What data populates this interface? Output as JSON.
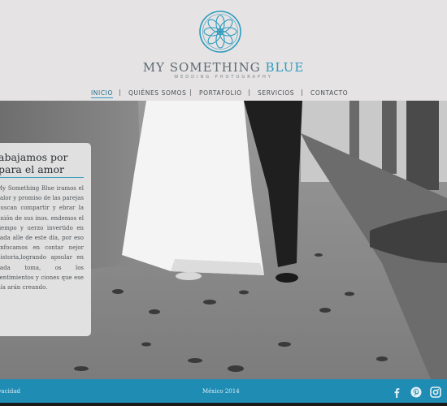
{
  "brand": {
    "name_part1": "MY SOMETHING ",
    "name_part2": "BLUE",
    "tagline": "WEDDING PHOTOGRAPHY",
    "accent_color": "#2d9bbd",
    "logo_icon": "mandala-icon"
  },
  "nav": {
    "items": [
      {
        "label": "INICIO",
        "active": true
      },
      {
        "label": "QUIÉNES SOMOS",
        "active": false
      },
      {
        "label": "PORTAFOLIO",
        "active": false
      },
      {
        "label": "SERVICIOS",
        "active": false
      },
      {
        "label": "CONTACTO",
        "active": false
      }
    ],
    "separator": "|"
  },
  "card": {
    "title": "abajamos por\npara el amor",
    "body": "My Something Blue iramos el valor y promiso de las parejas buscan compartir y ebrar la unión de sus inos. endemos el tiempo y uerzo invertido en cada alle de este día, por eso enfocamos en contar nejor historia,logrando apsular en cada toma, os los sentimientos y ciones que ese día arán creando."
  },
  "footer": {
    "privacy": "rivacidad",
    "country": "México 2014",
    "social_icons": [
      "facebook-icon",
      "pinterest-icon",
      "instagram-icon"
    ],
    "color": "#1f8cb4"
  }
}
